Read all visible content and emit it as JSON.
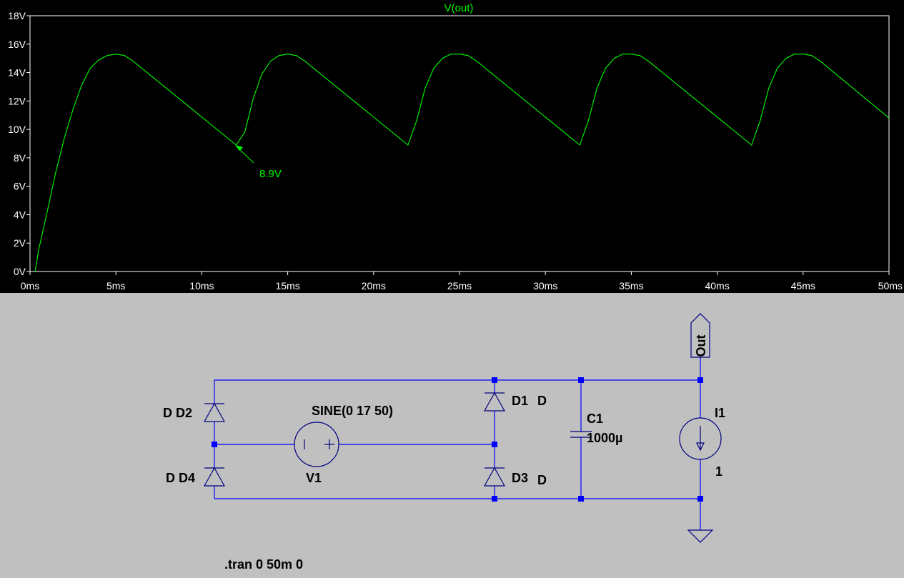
{
  "plot": {
    "trace_title": "V(out)",
    "cursor_label": "8.9V",
    "trace_color": "#00ff00",
    "background": "#000000",
    "axis_color": "#ffffff"
  },
  "chart_data": {
    "type": "line",
    "title": "V(out)",
    "xlabel": "",
    "ylabel": "",
    "xlim": [
      0,
      50
    ],
    "ylim": [
      0,
      18
    ],
    "x_unit": "ms",
    "y_unit": "V",
    "x_ticks": [
      "0ms",
      "5ms",
      "10ms",
      "15ms",
      "20ms",
      "25ms",
      "30ms",
      "35ms",
      "40ms",
      "45ms",
      "50ms"
    ],
    "y_ticks": [
      "0V",
      "2V",
      "4V",
      "6V",
      "8V",
      "10V",
      "12V",
      "14V",
      "16V",
      "18V"
    ],
    "series": [
      {
        "x": [
          0.3,
          0.5,
          1,
          1.5,
          2,
          2.5,
          3,
          3.5,
          4,
          4.5,
          5,
          5.5,
          6,
          12,
          12.5,
          13,
          13.5,
          14,
          14.5,
          15,
          15.5,
          16,
          22,
          22.5,
          23,
          23.5,
          24,
          24.5,
          25,
          25.5,
          26,
          32,
          32.5,
          33,
          33.5,
          34,
          34.5,
          35,
          35.5,
          36,
          42,
          42.5,
          43,
          43.5,
          44,
          44.5,
          45,
          45.5,
          46,
          50
        ],
        "y": [
          0,
          1.5,
          4.2,
          7,
          9.4,
          11.4,
          13.1,
          14.3,
          14.9,
          15.2,
          15.3,
          15.2,
          14.8,
          8.9,
          9.8,
          12.2,
          13.9,
          14.8,
          15.2,
          15.3,
          15.2,
          14.8,
          8.9,
          10.6,
          12.9,
          14.3,
          15.0,
          15.3,
          15.3,
          15.2,
          14.8,
          8.9,
          10.6,
          12.9,
          14.3,
          15.0,
          15.3,
          15.3,
          15.2,
          14.8,
          8.9,
          10.6,
          12.9,
          14.3,
          15.0,
          15.3,
          15.3,
          15.2,
          14.8,
          10.8
        ]
      }
    ],
    "annotations": [
      {
        "text": "8.9V",
        "x": 12,
        "y": 8.9
      }
    ],
    "grid": false,
    "legend": "none"
  },
  "schematic": {
    "d2_label": "D D2",
    "d4_label": "D D4",
    "d1_label": "D1",
    "d1_model": "D",
    "d3_label": "D3",
    "d3_model": "D",
    "source_value": "SINE(0 17 50)",
    "source_name": "V1",
    "cap_name": "C1",
    "cap_value": "1000µ",
    "isrc_name": "I1",
    "isrc_value": "1",
    "net_label": "Out",
    "directive": ".tran 0 50m 0",
    "wire_color": "#0000ff"
  }
}
